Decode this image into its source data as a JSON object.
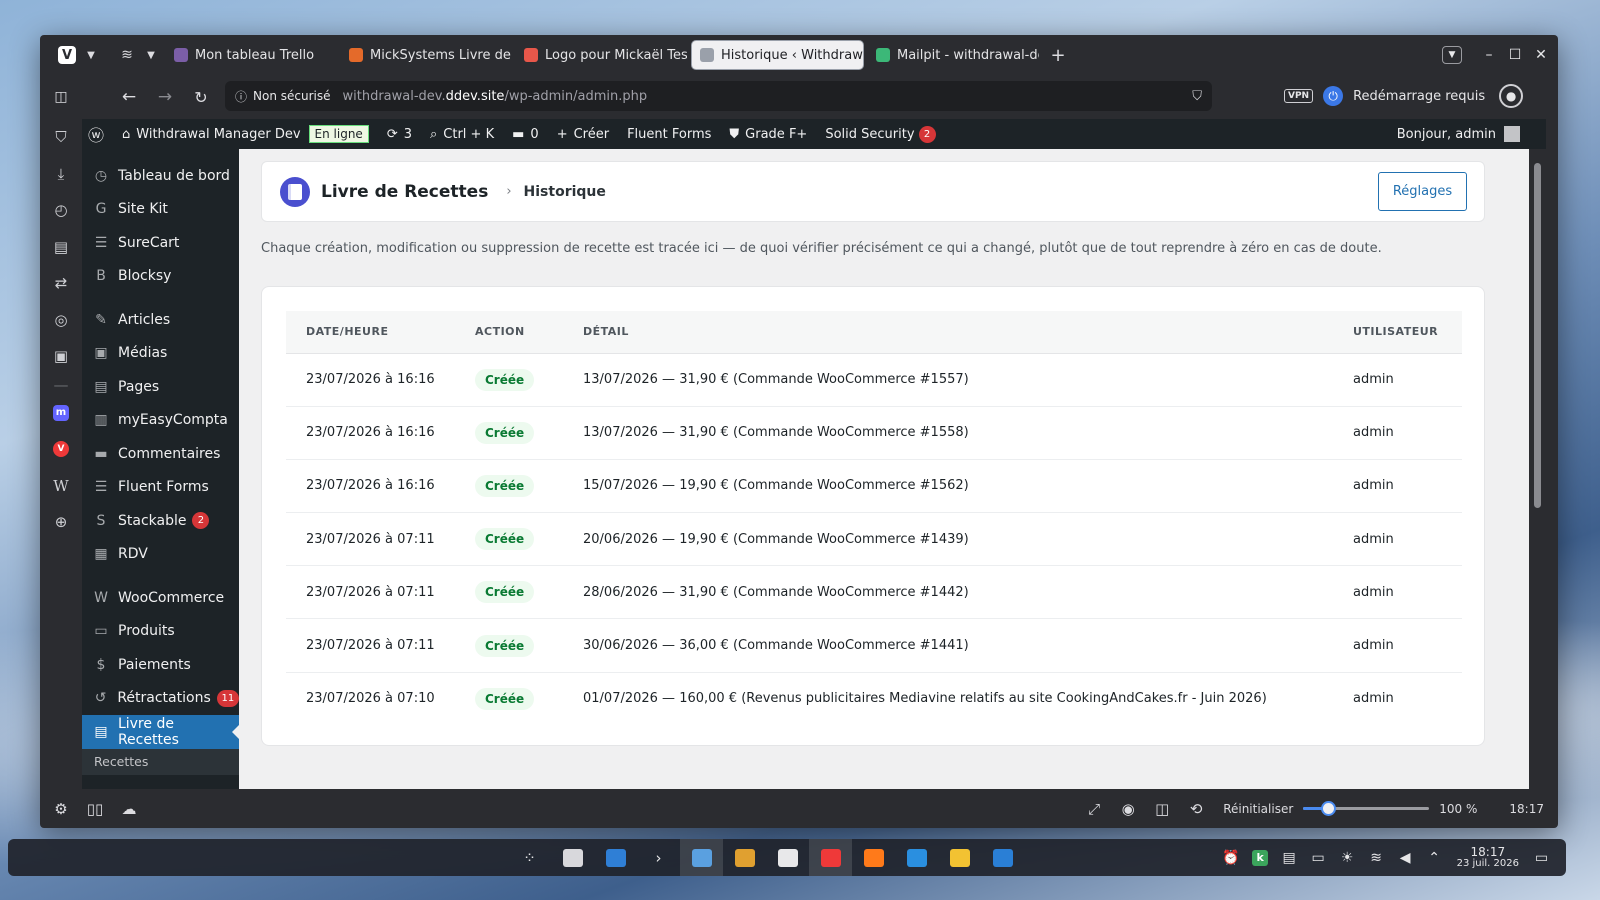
{
  "browser": {
    "tabs": [
      {
        "label": "Mon tableau Trello",
        "color": "#7b5ea7"
      },
      {
        "label": "MickSystems Livre de R...",
        "color": "#e46a2a"
      },
      {
        "label": "Logo pour Mickaël Tessi...",
        "color": "#e8574a"
      },
      {
        "label": "Historique ‹ Withdrawal M",
        "color": "#9aa0aa",
        "active": true
      },
      {
        "label": "Mailpit - withdrawal-dev...",
        "color": "#3cb878"
      }
    ],
    "new_tab": "+",
    "security_label": "Non sécurisé",
    "url_pre": "withdrawal-dev.",
    "url_host": "ddev.site",
    "url_post": "/wp-admin/admin.php",
    "vpn": "VPN",
    "restart": "Redémarrage requis"
  },
  "adminbar": {
    "site": "Withdrawal Manager Dev",
    "online": "En ligne",
    "updates": "3",
    "search": "Ctrl + K",
    "comments": "0",
    "create": "Créer",
    "fluent": "Fluent Forms",
    "grade": "Grade F+",
    "security": "Solid Security",
    "security_count": "2",
    "greeting": "Bonjour, admin"
  },
  "sidebar": {
    "items": [
      {
        "label": "Tableau de bord",
        "icon": "◷"
      },
      {
        "label": "Site Kit",
        "icon": "G"
      },
      {
        "label": "SureCart",
        "icon": "☰"
      },
      {
        "label": "Blocksy",
        "icon": "B"
      },
      {
        "label": "Articles",
        "icon": "✎"
      },
      {
        "label": "Médias",
        "icon": "▣"
      },
      {
        "label": "Pages",
        "icon": "▤"
      },
      {
        "label": "myEasyCompta",
        "icon": "▥"
      },
      {
        "label": "Commentaires",
        "icon": "▬"
      },
      {
        "label": "Fluent Forms",
        "icon": "☰"
      },
      {
        "label": "Stackable",
        "icon": "S",
        "badge": "2"
      },
      {
        "label": "RDV",
        "icon": "▦"
      },
      {
        "label": "WooCommerce",
        "icon": "W"
      },
      {
        "label": "Produits",
        "icon": "▭"
      },
      {
        "label": "Paiements",
        "icon": "$"
      },
      {
        "label": "Rétractations",
        "icon": "↺",
        "badge": "11"
      },
      {
        "label": "Livre de Recettes",
        "icon": "▤",
        "active": true
      }
    ],
    "submenu": "Recettes"
  },
  "page": {
    "title": "Livre de Recettes",
    "breadcrumb_sep": "›",
    "breadcrumb": "Historique",
    "settings_button": "Réglages",
    "intro": "Chaque création, modification ou suppression de recette est tracée ici — de quoi vérifier précisément ce qui a changé, plutôt que de tout reprendre à zéro en cas de doute."
  },
  "table": {
    "headers": [
      "DATE/HEURE",
      "ACTION",
      "DÉTAIL",
      "UTILISATEUR"
    ],
    "rows": [
      [
        "23/07/2026 à 16:16",
        "Créée",
        "13/07/2026 — 31,90 € (Commande WooCommerce #1557)",
        "admin"
      ],
      [
        "23/07/2026 à 16:16",
        "Créée",
        "13/07/2026 — 31,90 € (Commande WooCommerce #1558)",
        "admin"
      ],
      [
        "23/07/2026 à 16:16",
        "Créée",
        "15/07/2026 — 19,90 € (Commande WooCommerce #1562)",
        "admin"
      ],
      [
        "23/07/2026 à 07:11",
        "Créée",
        "20/06/2026 — 19,90 € (Commande WooCommerce #1439)",
        "admin"
      ],
      [
        "23/07/2026 à 07:11",
        "Créée",
        "28/06/2026 — 31,90 € (Commande WooCommerce #1442)",
        "admin"
      ],
      [
        "23/07/2026 à 07:11",
        "Créée",
        "30/06/2026 — 36,00 € (Commande WooCommerce #1441)",
        "admin"
      ],
      [
        "23/07/2026 à 07:10",
        "Créée",
        "01/07/2026 — 160,00 € (Revenus publicitaires Mediavine relatifs au site CookingAndCakes.fr - Juin 2026)",
        "admin"
      ]
    ]
  },
  "statusbar": {
    "reset": "Réinitialiser",
    "zoom": "100 %",
    "zoom_value": 0.2,
    "time": "18:17"
  },
  "taskbar": {
    "time": "18:17",
    "date": "23 juil. 2026",
    "apps": [
      {
        "icon": "⁘",
        "color": ""
      },
      {
        "icon": "",
        "color": "#d8d8dc"
      },
      {
        "icon": "",
        "color": "#2f7fd6"
      },
      {
        "icon": "›",
        "color": ""
      },
      {
        "icon": "",
        "color": "#5aa0e0"
      },
      {
        "icon": "",
        "color": "#e0a030"
      },
      {
        "icon": "",
        "color": "#e8e8ea"
      },
      {
        "icon": "",
        "color": "#ef3939"
      },
      {
        "icon": "",
        "color": "#ff7a1a"
      },
      {
        "icon": "",
        "color": "#2a8fe0"
      },
      {
        "icon": "",
        "color": "#f2c232"
      },
      {
        "icon": "",
        "color": "#2a7fd6"
      }
    ]
  }
}
